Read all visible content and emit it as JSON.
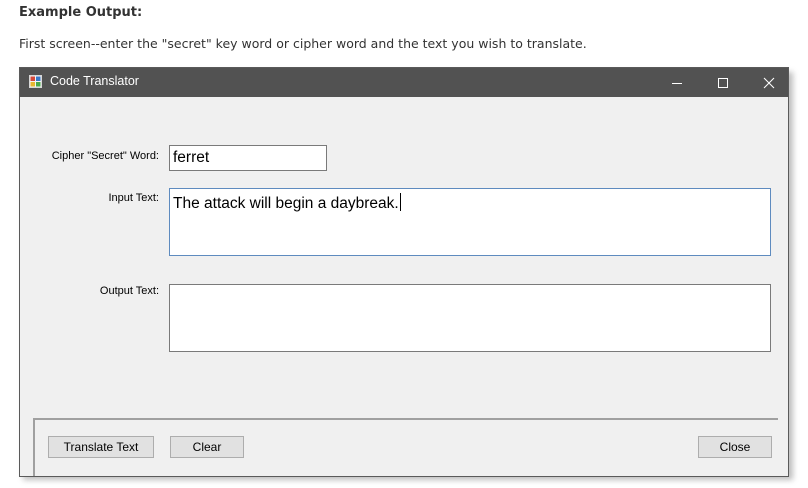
{
  "document": {
    "heading": "Example Output:",
    "intro": "First screen--enter the \"secret\" key word or cipher word and the text you wish to translate."
  },
  "window": {
    "title": "Code Translator",
    "icon": "app-icon",
    "controls": {
      "minimize": "minimize-icon",
      "maximize": "maximize-icon",
      "close": "close-icon"
    }
  },
  "form": {
    "cipher_label": "Cipher \"Secret\" Word:",
    "cipher_value": "ferret",
    "input_label": "Input Text:",
    "input_value": "The attack will begin a daybreak.",
    "output_label": "Output Text:",
    "output_value": ""
  },
  "buttons": {
    "translate": "Translate Text",
    "clear": "Clear",
    "close": "Close"
  },
  "colors": {
    "titlebar": "#525252",
    "window_bg": "#f0f0f0",
    "focus_border": "#5e8bbf",
    "button_bg": "#e1e1e1"
  }
}
